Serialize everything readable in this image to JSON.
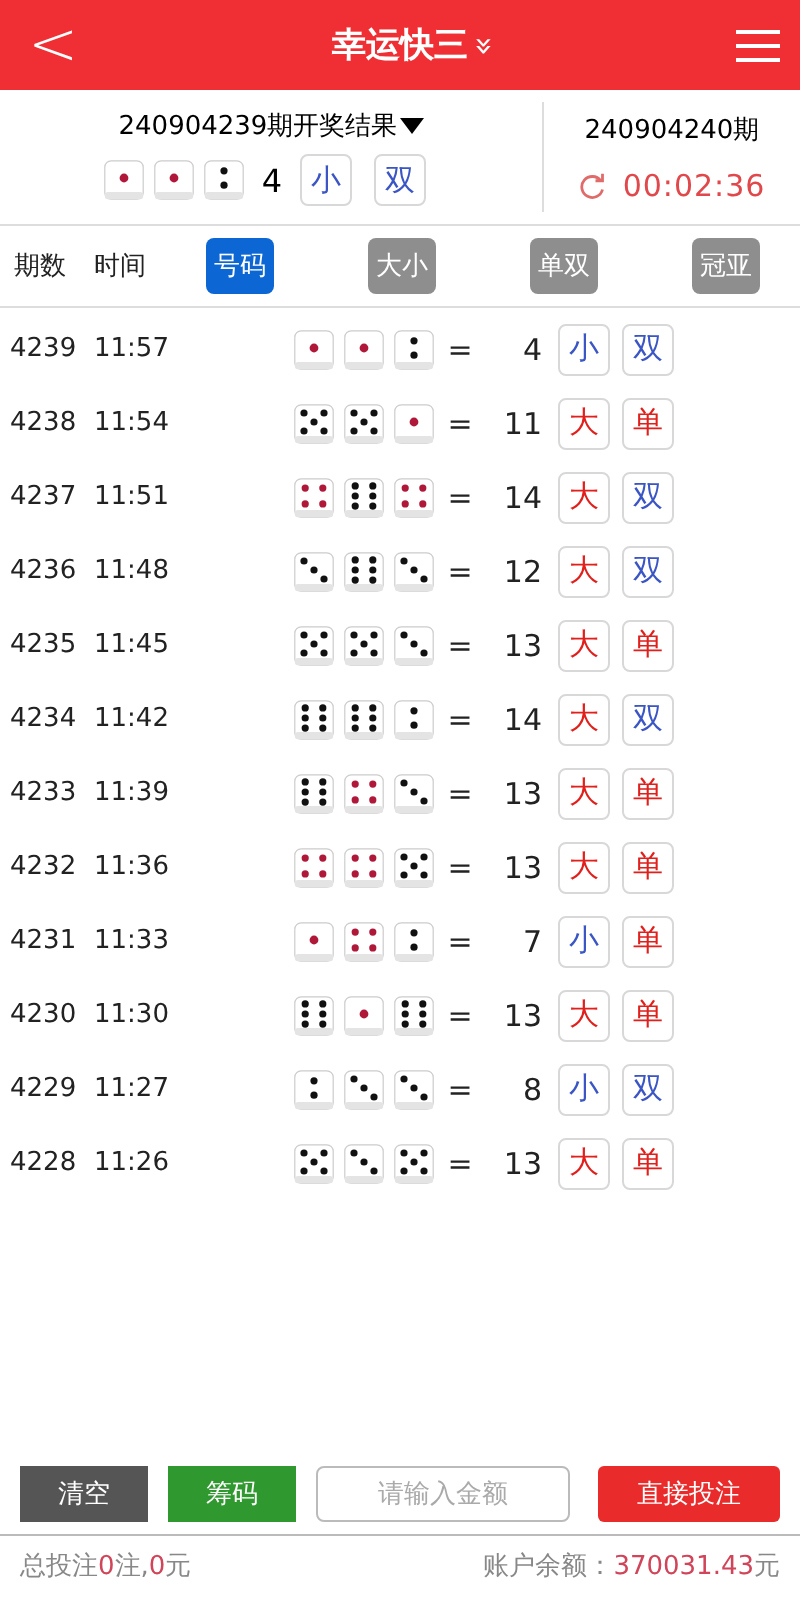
{
  "header": {
    "back": "<",
    "title": "幸运快三",
    "title_caret": "»"
  },
  "last_draw": {
    "title": "240904239期开奖结果",
    "dice": [
      {
        "kind": "one"
      },
      {
        "kind": "one"
      },
      {
        "kind": "two"
      }
    ],
    "sum": "4",
    "tags": [
      {
        "text": "小",
        "color": "#3b56c4"
      },
      {
        "text": "双",
        "color": "#3b56c4"
      }
    ]
  },
  "next_draw": {
    "title": "240904240期",
    "countdown": "00:02:36"
  },
  "columns": [
    {
      "label": "期数",
      "kind": "text"
    },
    {
      "label": "时间",
      "kind": "text"
    },
    {
      "label": "号码",
      "kind": "tab",
      "selected": true
    },
    {
      "label": "大小",
      "kind": "tab",
      "selected": false
    },
    {
      "label": "单双",
      "kind": "tab",
      "selected": false
    },
    {
      "label": "冠亚",
      "kind": "tab",
      "selected": false
    }
  ],
  "rows": [
    {
      "period": "4239",
      "time": "11:57",
      "dice": [
        {
          "kind": "one"
        },
        {
          "kind": "one"
        },
        {
          "kind": "two"
        }
      ],
      "sum": "4",
      "tags": [
        {
          "text": "小",
          "color": "#3b56c4"
        },
        {
          "text": "双",
          "color": "#3b56c4"
        }
      ]
    },
    {
      "period": "4238",
      "time": "11:54",
      "dice": [
        {
          "kind": "five"
        },
        {
          "kind": "five"
        },
        {
          "kind": "one"
        }
      ],
      "sum": "11",
      "tags": [
        {
          "text": "大",
          "color": "#e0201c"
        },
        {
          "text": "单",
          "color": "#e0201c"
        }
      ]
    },
    {
      "period": "4237",
      "time": "11:51",
      "dice": [
        {
          "kind": "four"
        },
        {
          "kind": "six"
        },
        {
          "kind": "four"
        }
      ],
      "sum": "14",
      "tags": [
        {
          "text": "大",
          "color": "#e0201c"
        },
        {
          "text": "双",
          "color": "#3b56c4"
        }
      ]
    },
    {
      "period": "4236",
      "time": "11:48",
      "dice": [
        {
          "kind": "three"
        },
        {
          "kind": "six"
        },
        {
          "kind": "three"
        }
      ],
      "sum": "12",
      "tags": [
        {
          "text": "大",
          "color": "#e0201c"
        },
        {
          "text": "双",
          "color": "#3b56c4"
        }
      ]
    },
    {
      "period": "4235",
      "time": "11:45",
      "dice": [
        {
          "kind": "five"
        },
        {
          "kind": "five"
        },
        {
          "kind": "three"
        }
      ],
      "sum": "13",
      "tags": [
        {
          "text": "大",
          "color": "#e0201c"
        },
        {
          "text": "单",
          "color": "#e0201c"
        }
      ]
    },
    {
      "period": "4234",
      "time": "11:42",
      "dice": [
        {
          "kind": "six"
        },
        {
          "kind": "six"
        },
        {
          "kind": "two"
        }
      ],
      "sum": "14",
      "tags": [
        {
          "text": "大",
          "color": "#e0201c"
        },
        {
          "text": "双",
          "color": "#3b56c4"
        }
      ]
    },
    {
      "period": "4233",
      "time": "11:39",
      "dice": [
        {
          "kind": "six"
        },
        {
          "kind": "four"
        },
        {
          "kind": "three"
        }
      ],
      "sum": "13",
      "tags": [
        {
          "text": "大",
          "color": "#e0201c"
        },
        {
          "text": "单",
          "color": "#e0201c"
        }
      ]
    },
    {
      "period": "4232",
      "time": "11:36",
      "dice": [
        {
          "kind": "four"
        },
        {
          "kind": "four"
        },
        {
          "kind": "five"
        }
      ],
      "sum": "13",
      "tags": [
        {
          "text": "大",
          "color": "#e0201c"
        },
        {
          "text": "单",
          "color": "#e0201c"
        }
      ]
    },
    {
      "period": "4231",
      "time": "11:33",
      "dice": [
        {
          "kind": "one"
        },
        {
          "kind": "four"
        },
        {
          "kind": "two"
        }
      ],
      "sum": "7",
      "tags": [
        {
          "text": "小",
          "color": "#3b56c4"
        },
        {
          "text": "单",
          "color": "#e0201c"
        }
      ]
    },
    {
      "period": "4230",
      "time": "11:30",
      "dice": [
        {
          "kind": "six"
        },
        {
          "kind": "one"
        },
        {
          "kind": "six"
        }
      ],
      "sum": "13",
      "tags": [
        {
          "text": "大",
          "color": "#e0201c"
        },
        {
          "text": "单",
          "color": "#e0201c"
        }
      ]
    },
    {
      "period": "4229",
      "time": "11:27",
      "dice": [
        {
          "kind": "two"
        },
        {
          "kind": "three"
        },
        {
          "kind": "three"
        }
      ],
      "sum": "8",
      "tags": [
        {
          "text": "小",
          "color": "#3b56c4"
        },
        {
          "text": "双",
          "color": "#3b56c4"
        }
      ]
    },
    {
      "period": "4228",
      "time": "11:26",
      "dice": [
        {
          "kind": "five"
        },
        {
          "kind": "three"
        },
        {
          "kind": "five"
        }
      ],
      "sum": "13",
      "tags": [
        {
          "text": "大",
          "color": "#e0201c"
        },
        {
          "text": "单",
          "color": "#e0201c"
        }
      ]
    }
  ],
  "equals": "=",
  "actions": [
    {
      "label": "清空",
      "kind": "clear"
    },
    {
      "label": "筹码",
      "kind": "chips"
    },
    {
      "placeholder": "请输入金额",
      "kind": "amount"
    },
    {
      "label": "直接投注",
      "kind": "submit"
    }
  ],
  "footer": {
    "total_label": "总投注",
    "bet_count": "0",
    "bet_unit": "注,",
    "amount": "0",
    "amount_unit": "元",
    "balance_label": "账户余额：",
    "balance": "370031.43",
    "balance_unit": "元"
  }
}
